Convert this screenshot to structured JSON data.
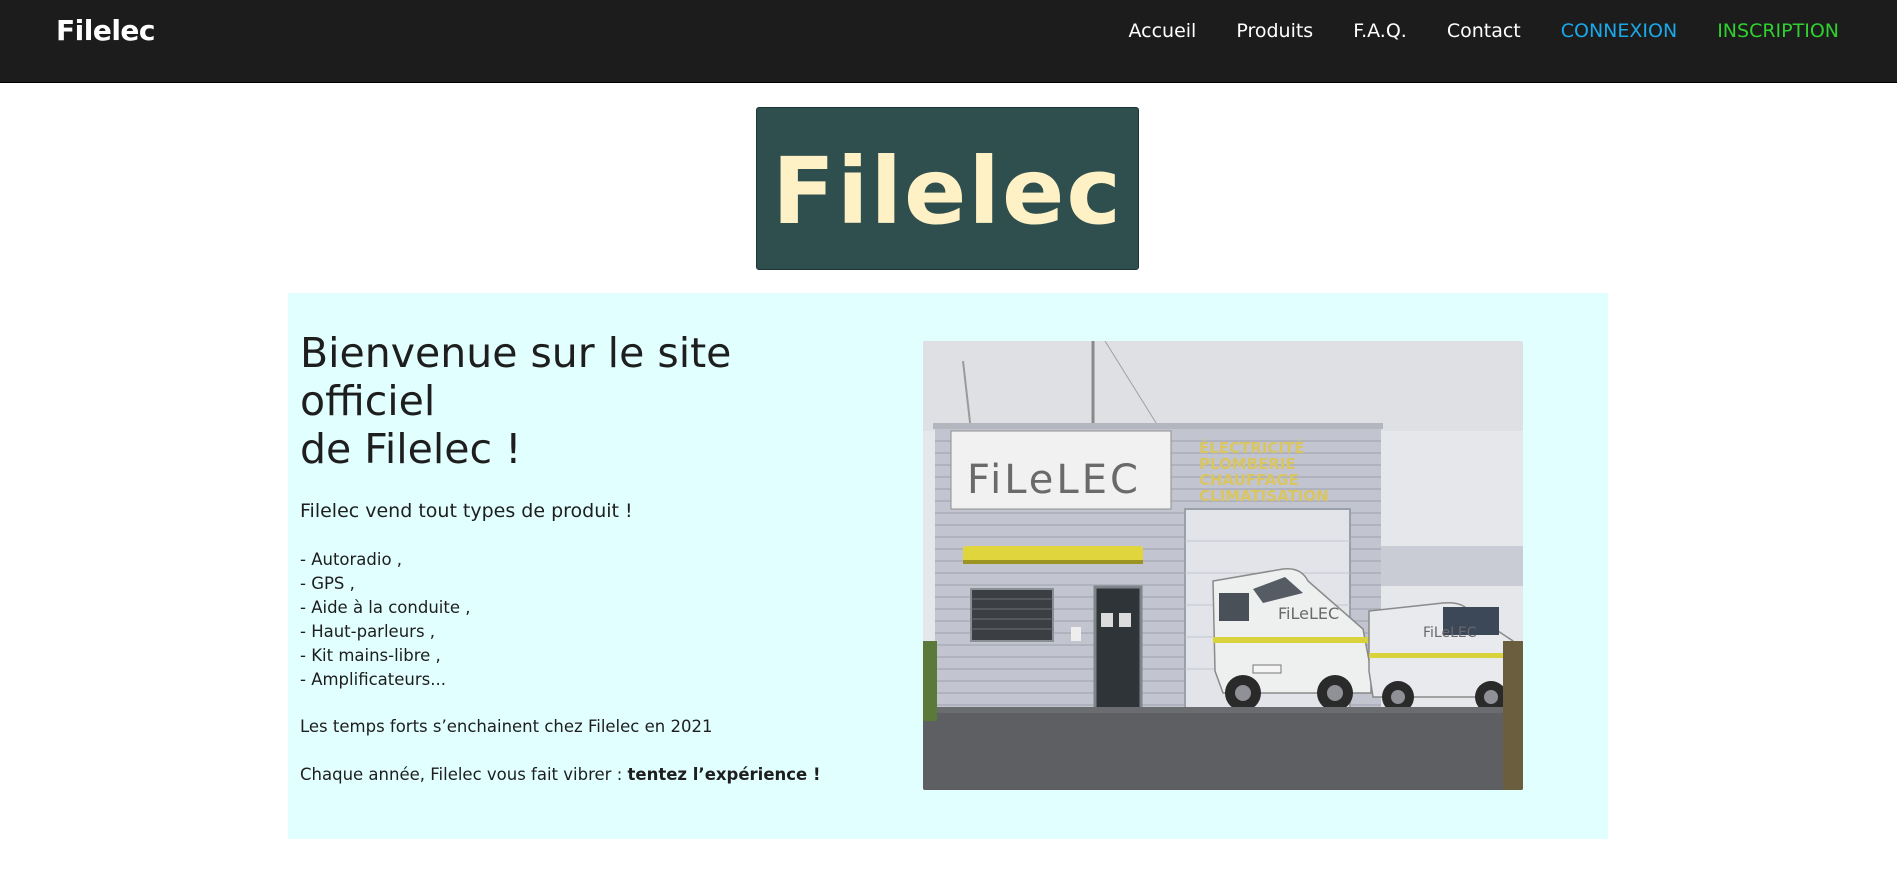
{
  "nav": {
    "brand": "Filelec",
    "links": [
      {
        "label": "Accueil"
      },
      {
        "label": "Produits"
      },
      {
        "label": "F.A.Q."
      },
      {
        "label": "Contact"
      },
      {
        "label": "CONNEXION"
      },
      {
        "label": "INSCRIPTION"
      }
    ]
  },
  "logo": {
    "text": "Filelec",
    "bg_color": "#2f4f4f",
    "text_color": "#fdf1c5"
  },
  "main": {
    "heading_line1": "Bienvenue sur le site officiel",
    "heading_line2": "de Filelec !",
    "intro": "Filelec vend tout types de produit !",
    "products": [
      "- Autoradio ,",
      "- GPS ,",
      "- Aide à la conduite ,",
      "- Haut-parleurs ,",
      "- Kit mains-libre ,",
      "- Amplificateurs..."
    ],
    "para1": "Les temps forts s’enchainent chez Filelec en 2021",
    "para2_prefix": "Chaque année, Filelec vous fait vibrer : ",
    "para2_bold": "tentez l’expérience !",
    "panel_color": "#e0fffe"
  },
  "photo": {
    "sign_brand": "FiLeLEC",
    "sign_services": [
      "ÉLECTRICITÉ",
      "PLOMBERIE",
      "CHAUFFAGE",
      "CLIMATISATION"
    ],
    "van_label": "FiLeLEC"
  },
  "colors": {
    "navbar": "#1c1c1c",
    "login": "#1aa8e8",
    "signup": "#2fd12f"
  }
}
